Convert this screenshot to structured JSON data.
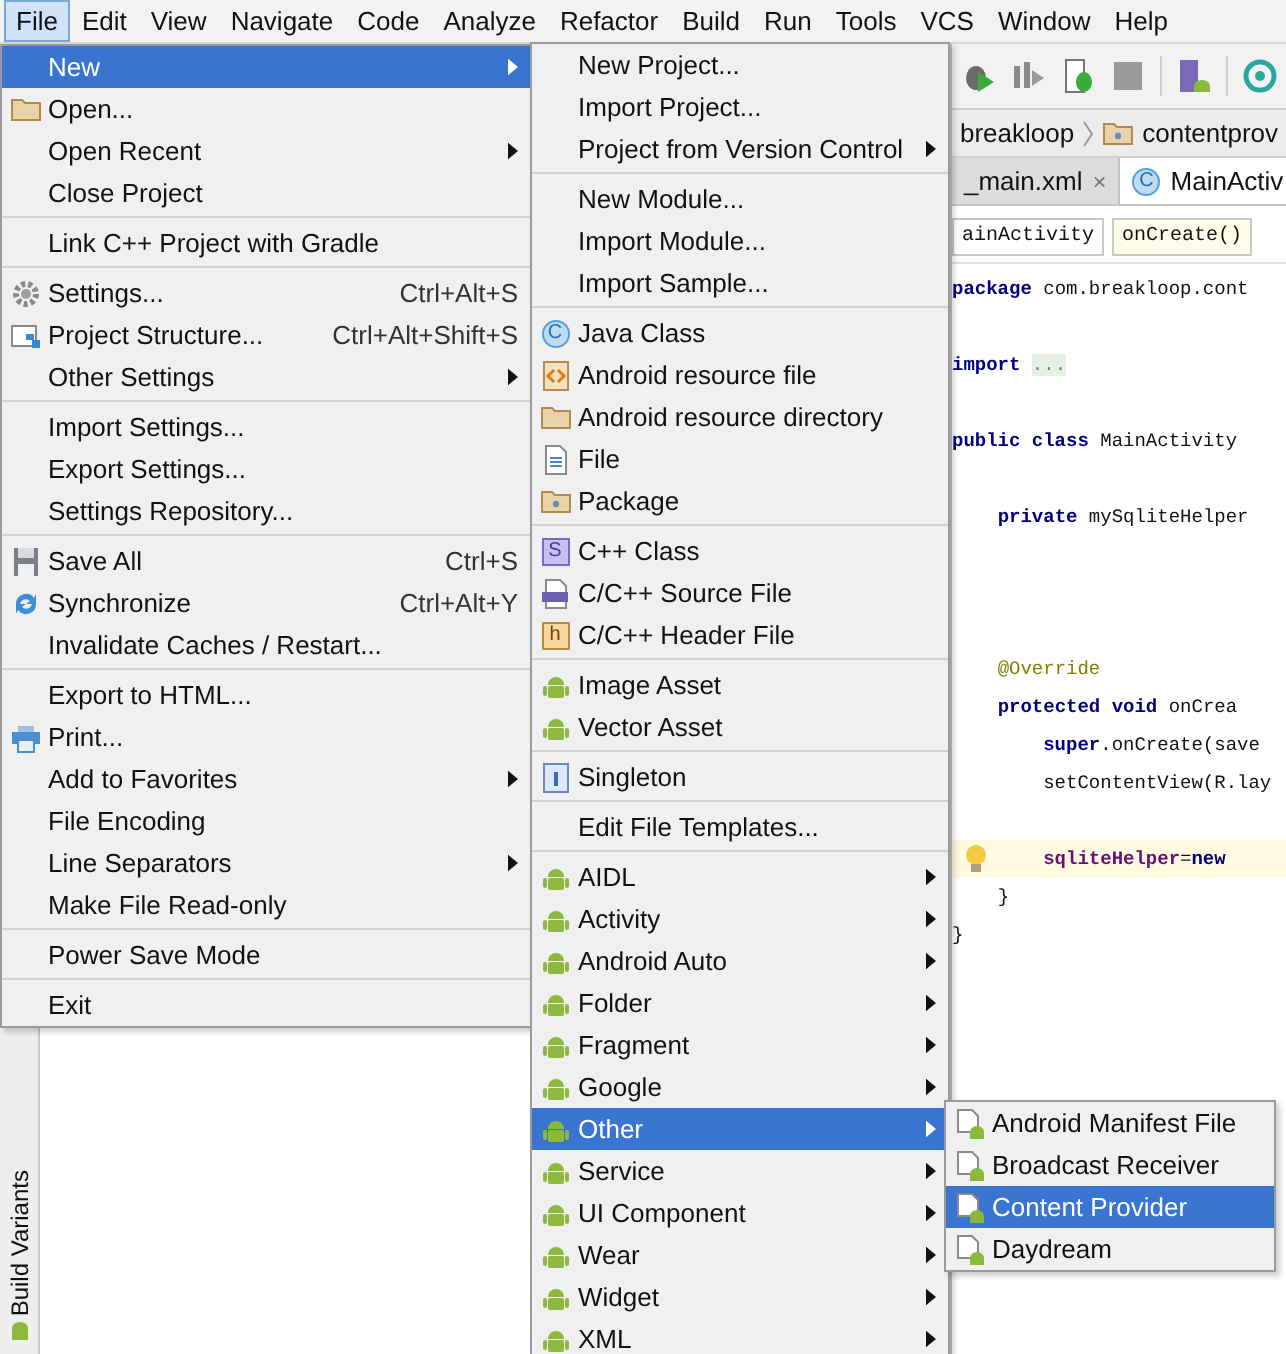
{
  "menubar": [
    {
      "label": "File",
      "selected": true
    },
    {
      "label": "Edit",
      "selected": false
    },
    {
      "label": "View",
      "selected": false
    },
    {
      "label": "Navigate",
      "selected": false
    },
    {
      "label": "Code",
      "selected": false
    },
    {
      "label": "Analyze",
      "selected": false
    },
    {
      "label": "Refactor",
      "selected": false
    },
    {
      "label": "Build",
      "selected": false
    },
    {
      "label": "Run",
      "selected": false
    },
    {
      "label": "Tools",
      "selected": false
    },
    {
      "label": "VCS",
      "selected": false
    },
    {
      "label": "Window",
      "selected": false
    },
    {
      "label": "Help",
      "selected": false
    }
  ],
  "file_menu": {
    "groups": [
      [
        {
          "label": "New",
          "selected": true,
          "submenu": true
        },
        {
          "label": "Open...",
          "selected": false,
          "submenu": false
        },
        {
          "label": "Open Recent",
          "selected": false,
          "submenu": true
        },
        {
          "label": "Close Project",
          "selected": false,
          "submenu": false
        }
      ],
      [
        {
          "label": "Link C++ Project with Gradle",
          "selected": false,
          "submenu": false
        }
      ],
      [
        {
          "label": "Settings...",
          "shortcut": "Ctrl+Alt+S",
          "selected": false,
          "submenu": false
        },
        {
          "label": "Project Structure...",
          "shortcut": "Ctrl+Alt+Shift+S",
          "selected": false,
          "submenu": false
        },
        {
          "label": "Other Settings",
          "selected": false,
          "submenu": true
        }
      ],
      [
        {
          "label": "Import Settings...",
          "selected": false,
          "submenu": false
        },
        {
          "label": "Export Settings...",
          "selected": false,
          "submenu": false
        },
        {
          "label": "Settings Repository...",
          "selected": false,
          "submenu": false
        }
      ],
      [
        {
          "label": "Save All",
          "shortcut": "Ctrl+S",
          "selected": false,
          "submenu": false
        },
        {
          "label": "Synchronize",
          "shortcut": "Ctrl+Alt+Y",
          "selected": false,
          "submenu": false
        },
        {
          "label": "Invalidate Caches / Restart...",
          "selected": false,
          "submenu": false
        }
      ],
      [
        {
          "label": "Export to HTML...",
          "selected": false,
          "submenu": false
        },
        {
          "label": "Print...",
          "selected": false,
          "submenu": false
        },
        {
          "label": "Add to Favorites",
          "selected": false,
          "submenu": true
        },
        {
          "label": "File Encoding",
          "selected": false,
          "submenu": false
        },
        {
          "label": "Line Separators",
          "selected": false,
          "submenu": true
        },
        {
          "label": "Make File Read-only",
          "selected": false,
          "submenu": false
        }
      ],
      [
        {
          "label": "Power Save Mode",
          "selected": false,
          "submenu": false
        }
      ],
      [
        {
          "label": "Exit",
          "selected": false,
          "submenu": false
        }
      ]
    ]
  },
  "new_menu": {
    "groups": [
      [
        {
          "label": "New Project...",
          "selected": false,
          "submenu": false
        },
        {
          "label": "Import Project...",
          "selected": false,
          "submenu": false
        },
        {
          "label": "Project from Version Control",
          "selected": false,
          "submenu": true
        }
      ],
      [
        {
          "label": "New Module...",
          "selected": false,
          "submenu": false
        },
        {
          "label": "Import Module...",
          "selected": false,
          "submenu": false
        },
        {
          "label": "Import Sample...",
          "selected": false,
          "submenu": false
        }
      ],
      [
        {
          "label": "Java Class",
          "badge": "C",
          "selected": false,
          "submenu": false
        },
        {
          "label": "Android resource file",
          "selected": false,
          "submenu": false
        },
        {
          "label": "Android resource directory",
          "selected": false,
          "submenu": false
        },
        {
          "label": "File",
          "selected": false,
          "submenu": false
        },
        {
          "label": "Package",
          "selected": false,
          "submenu": false
        }
      ],
      [
        {
          "label": "C++ Class",
          "badge": "S",
          "selected": false,
          "submenu": false
        },
        {
          "label": "C/C++ Source File",
          "selected": false,
          "submenu": false
        },
        {
          "label": "C/C++ Header File",
          "badge": "h",
          "selected": false,
          "submenu": false
        }
      ],
      [
        {
          "label": "Image Asset",
          "selected": false,
          "submenu": false
        },
        {
          "label": "Vector Asset",
          "selected": false,
          "submenu": false
        }
      ],
      [
        {
          "label": "Singleton",
          "selected": false,
          "submenu": false
        }
      ],
      [
        {
          "label": "Edit File Templates...",
          "selected": false,
          "submenu": false
        }
      ],
      [
        {
          "label": "AIDL",
          "selected": false,
          "submenu": true
        },
        {
          "label": "Activity",
          "selected": false,
          "submenu": true
        },
        {
          "label": "Android Auto",
          "selected": false,
          "submenu": true
        },
        {
          "label": "Folder",
          "selected": false,
          "submenu": true
        },
        {
          "label": "Fragment",
          "selected": false,
          "submenu": true
        },
        {
          "label": "Google",
          "selected": false,
          "submenu": true
        },
        {
          "label": "Other",
          "selected": true,
          "submenu": true
        },
        {
          "label": "Service",
          "selected": false,
          "submenu": true
        },
        {
          "label": "UI Component",
          "selected": false,
          "submenu": true
        },
        {
          "label": "Wear",
          "selected": false,
          "submenu": true
        },
        {
          "label": "Widget",
          "selected": false,
          "submenu": true
        },
        {
          "label": "XML",
          "selected": false,
          "submenu": true
        }
      ]
    ]
  },
  "other_menu": {
    "items": [
      {
        "label": "Android Manifest File",
        "selected": false
      },
      {
        "label": "Broadcast Receiver",
        "selected": false
      },
      {
        "label": "Content Provider",
        "selected": true
      },
      {
        "label": "Daydream",
        "selected": false
      }
    ]
  },
  "toolstrip": {
    "label": "Build Variants"
  },
  "editor": {
    "breadcrumbs": [
      "breakloop",
      "contentprov"
    ],
    "tabs": [
      {
        "label": "_main.xml",
        "close": "×",
        "selected": false
      },
      {
        "label": "MainActiv",
        "badge": "C",
        "selected": true
      }
    ],
    "structure": [
      "ainActivity",
      "onCreate()"
    ],
    "code": [
      {
        "kind": "code",
        "current": false,
        "tokens": [
          {
            "kind": "keyword",
            "text": "package"
          },
          {
            "kind": "plain",
            "text": " com.breakloop.cont"
          }
        ]
      },
      {
        "kind": "blank",
        "current": false
      },
      {
        "kind": "code",
        "current": false,
        "tokens": [
          {
            "kind": "keyword",
            "text": "import "
          },
          {
            "kind": "folded",
            "text": "..."
          }
        ]
      },
      {
        "kind": "blank",
        "current": false
      },
      {
        "kind": "code",
        "current": false,
        "tokens": [
          {
            "kind": "keyword",
            "text": "public class"
          },
          {
            "kind": "plain",
            "text": " MainActivity"
          }
        ]
      },
      {
        "kind": "blank",
        "current": false
      },
      {
        "kind": "code",
        "current": false,
        "tokens": [
          {
            "kind": "keyword",
            "text": "    private"
          },
          {
            "kind": "plain",
            "text": " mySqliteHelper"
          }
        ]
      },
      {
        "kind": "blank",
        "current": false
      },
      {
        "kind": "blank",
        "current": false
      },
      {
        "kind": "blank",
        "current": false
      },
      {
        "kind": "code",
        "current": false,
        "tokens": [
          {
            "kind": "annotation",
            "text": "    @Override"
          }
        ]
      },
      {
        "kind": "code",
        "current": false,
        "tokens": [
          {
            "kind": "keyword",
            "text": "    protected void"
          },
          {
            "kind": "plain",
            "text": " onCrea"
          }
        ]
      },
      {
        "kind": "code",
        "current": false,
        "tokens": [
          {
            "kind": "keyword",
            "text": "        super"
          },
          {
            "kind": "plain",
            "text": ".onCreate(save"
          }
        ]
      },
      {
        "kind": "code",
        "current": false,
        "tokens": [
          {
            "kind": "plain",
            "text": "        setContentView(R.lay"
          }
        ]
      },
      {
        "kind": "blank",
        "current": false
      },
      {
        "kind": "code",
        "current": true,
        "tokens": [
          {
            "kind": "field",
            "text": "        sqliteHelper"
          },
          {
            "kind": "plain",
            "text": "="
          },
          {
            "kind": "keyword",
            "text": "new"
          }
        ]
      },
      {
        "kind": "code",
        "current": false,
        "tokens": [
          {
            "kind": "plain",
            "text": "    }"
          }
        ]
      },
      {
        "kind": "code",
        "current": false,
        "tokens": [
          {
            "kind": "plain",
            "text": "}"
          }
        ]
      }
    ]
  }
}
